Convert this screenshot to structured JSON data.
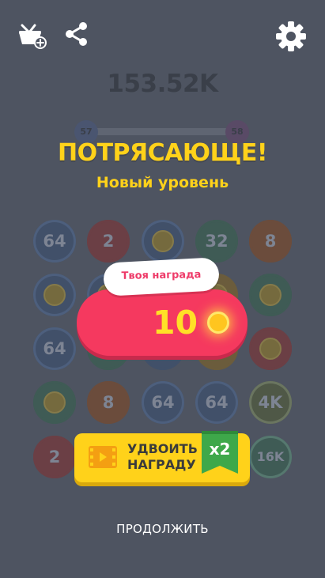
{
  "header": {
    "basket_icon": "basket-plus-icon",
    "share_icon": "share-icon",
    "settings_icon": "gear-icon"
  },
  "score": "153.52K",
  "level_progress": {
    "from_level": "57",
    "to_level": "58"
  },
  "headline": "ПОТРЯСАЮЩЕ!",
  "subheadline": "Новый уровень",
  "board": {
    "tiles": [
      {
        "label": "64",
        "color": "#415069",
        "ring": "#4d5f7d"
      },
      {
        "label": "2",
        "color": "#6b3f45",
        "ring": "#6b3f45"
      },
      {
        "label": "",
        "coin": true,
        "color": "#415069",
        "ring": "#4d5f7d"
      },
      {
        "label": "32",
        "color": "#3f5b55",
        "ring": "#3f5b55"
      },
      {
        "label": "8",
        "color": "#6b4c3c",
        "ring": "#6b4c3c"
      },
      {
        "label": "",
        "coin": true,
        "color": "#415069",
        "ring": "#4d5f7d"
      },
      {
        "label": "",
        "coin": true,
        "color": "#415069",
        "ring": "#4d5f7d"
      },
      {
        "label": "",
        "color": "#415069",
        "ring": "#415069"
      },
      {
        "label": "",
        "coin": true,
        "color": "#6b5c3c",
        "ring": "#6b5c3c"
      },
      {
        "label": "",
        "coin": true,
        "color": "#3f5b55",
        "ring": "#3f5b55"
      },
      {
        "label": "64",
        "color": "#415069",
        "ring": "#4d5f7d"
      },
      {
        "label": "",
        "color": "#3f5b55",
        "ring": "#3f5b55"
      },
      {
        "label": "",
        "color": "#415069",
        "ring": "#415069"
      },
      {
        "label": "",
        "color": "#6b5c3c",
        "ring": "#6b5c3c"
      },
      {
        "label": "",
        "coin": true,
        "color": "#6b3f45",
        "ring": "#6b3f45"
      },
      {
        "label": "",
        "coin": true,
        "color": "#3f5b55",
        "ring": "#3f5b55"
      },
      {
        "label": "8",
        "color": "#6b4c3c",
        "ring": "#6b4c3c"
      },
      {
        "label": "64",
        "color": "#415069",
        "ring": "#4d5f7d"
      },
      {
        "label": "64",
        "color": "#415069",
        "ring": "#4d5f7d"
      },
      {
        "label": "4K",
        "color": "#4f5847",
        "ring": "#6a7560"
      },
      {
        "label": "2",
        "color": "#6b3f45",
        "ring": "#6b3f45"
      },
      {
        "label": "",
        "color": "#4e5461",
        "ring": "#4e5461"
      },
      {
        "label": "",
        "color": "#4e5461",
        "ring": "#4e5461"
      },
      {
        "label": "",
        "color": "#4e5461",
        "ring": "#4e5461"
      },
      {
        "label": "16K",
        "color": "#3f5b55",
        "ring": "#56786f"
      }
    ]
  },
  "reward": {
    "tag": "Твоя награда",
    "amount": "10",
    "coin_icon": "coin-icon"
  },
  "double_button": {
    "label_line1": "УДВОИТЬ",
    "label_line2": "НАГРАДУ",
    "badge": "x2",
    "video_icon": "video-film-icon"
  },
  "continue_label": "ПРОДОЛЖИТЬ",
  "colors": {
    "background": "#4e5461",
    "accent_yellow": "#ffd21a",
    "reward_red": "#f5395f"
  }
}
